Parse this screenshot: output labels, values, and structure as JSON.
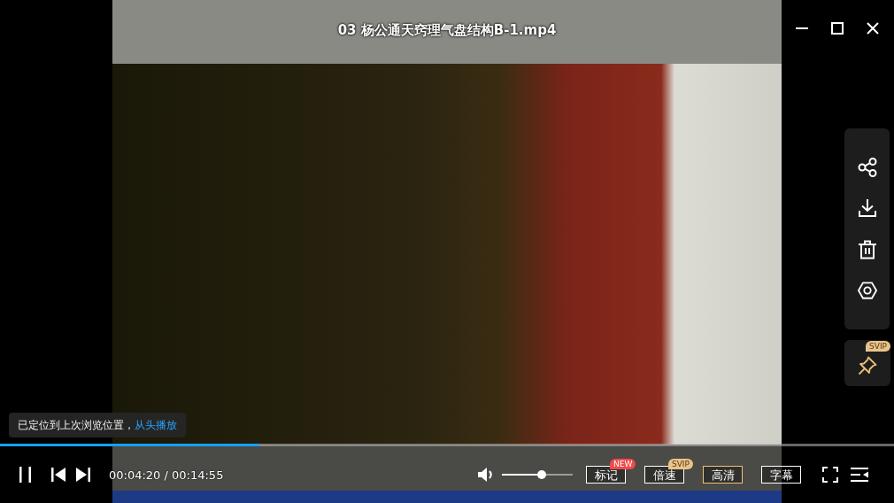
{
  "window": {
    "title": "03 杨公通天窍理气盘结构B-1.mp4"
  },
  "toast": {
    "message": "已定位到上次浏览位置，",
    "link": "从头播放"
  },
  "progress": {
    "level": 0.29
  },
  "controls": {
    "playing": true,
    "time": "00:04:20 / 00:14:55",
    "volume": {
      "level": 0.56
    },
    "buttons": [
      {
        "label": "标记",
        "active": false,
        "badge": {
          "text": "NEW",
          "color": "#f04a4a"
        }
      },
      {
        "label": "倍速",
        "active": false,
        "badge": {
          "text": "SVIP",
          "color": "#e8c48a"
        }
      },
      {
        "label": "高清",
        "active": true
      },
      {
        "label": "字幕",
        "active": false
      }
    ]
  },
  "pin_button": {
    "badge": {
      "text": "SVIP",
      "color": "#e8c48a"
    }
  }
}
